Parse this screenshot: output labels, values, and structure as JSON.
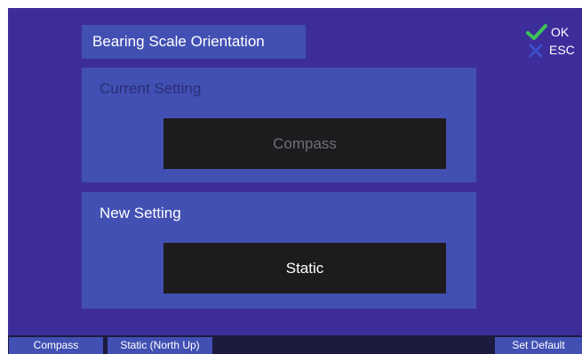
{
  "header": {
    "title": "Bearing Scale Orientation"
  },
  "actions": {
    "ok_label": "OK",
    "esc_label": "ESC",
    "ok_icon": "check-icon",
    "esc_icon": "x-icon",
    "ok_color": "#3ec35a",
    "esc_color": "#3b4fc9"
  },
  "current": {
    "label": "Current Setting",
    "value": "Compass"
  },
  "new": {
    "label": "New Setting",
    "value": "Static"
  },
  "softkeys": {
    "key1": "Compass",
    "key2": "Static (North Up)",
    "key6": "Set Default"
  },
  "colors": {
    "background": "#3d2d9a",
    "panel": "#4150b2",
    "value_box": "#1e1b1e"
  }
}
